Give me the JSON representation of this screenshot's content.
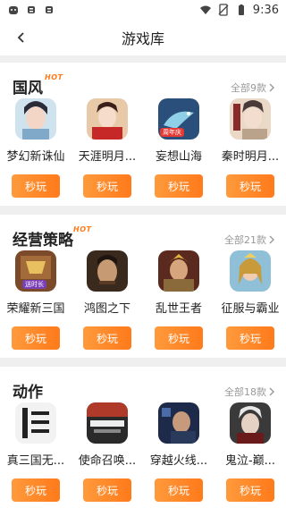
{
  "status_bar": {
    "time": "9:36",
    "left_icons": [
      "android-app-icon",
      "bug-icon",
      "bug-icon"
    ],
    "right_icons": [
      "wifi-icon",
      "sim-off-icon",
      "battery-icon"
    ]
  },
  "nav": {
    "title": "游戏库",
    "back_icon": "chevron-left-icon"
  },
  "colors": {
    "accent": "#ff8a2a",
    "hot": "#ff7a1a",
    "muted": "#999999"
  },
  "sections": [
    {
      "title": "国风",
      "badge": "HOT",
      "more_label": "全部9款",
      "games": [
        {
          "name": "梦幻新诛仙",
          "play_label": "秒玩",
          "icon": "fantasy-girl-icon"
        },
        {
          "name": "天涯明月...",
          "play_label": "秒玩",
          "icon": "red-robe-girl-icon"
        },
        {
          "name": "妄想山海",
          "play_label": "秒玩",
          "icon": "sea-beast-icon",
          "tag": "周年庆"
        },
        {
          "name": "秦时明月...",
          "play_label": "秒玩",
          "icon": "qin-moon-icon"
        }
      ]
    },
    {
      "title": "经营策略",
      "badge": "HOT",
      "more_label": "全部21款",
      "games": [
        {
          "name": "荣耀新三国",
          "play_label": "秒玩",
          "icon": "three-kingdoms-icon",
          "tag": "送时长"
        },
        {
          "name": "鸿图之下",
          "play_label": "秒玩",
          "icon": "warrior-face-icon"
        },
        {
          "name": "乱世王者",
          "play_label": "秒玩",
          "icon": "armored-king-icon"
        },
        {
          "name": "征服与霸业",
          "play_label": "秒玩",
          "icon": "queen-icon"
        }
      ]
    },
    {
      "title": "动作",
      "badge": "",
      "more_label": "全部18款",
      "games": [
        {
          "name": "真三国无...",
          "play_label": "秒玩",
          "icon": "dynasty-warriors-icon"
        },
        {
          "name": "使命召唤...",
          "play_label": "秒玩",
          "icon": "call-of-duty-icon"
        },
        {
          "name": "穿越火线...",
          "play_label": "秒玩",
          "icon": "crossfire-icon"
        },
        {
          "name": "鬼泣-巅...",
          "play_label": "秒玩",
          "icon": "devil-may-cry-icon"
        }
      ]
    }
  ]
}
